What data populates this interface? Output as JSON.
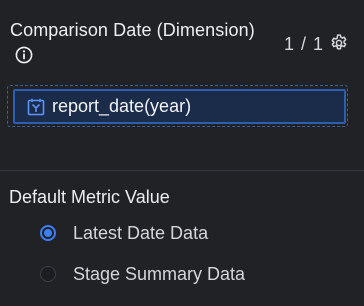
{
  "comparison_section": {
    "title": "Comparison Date (Dimension)",
    "info_icon": "info-circle-icon",
    "counter": "1 / 1",
    "settings_icon": "gear-icon",
    "field": {
      "icon": "date-field-icon",
      "label": "report_date(year)"
    }
  },
  "metric_section": {
    "title": "Default Metric Value",
    "options": [
      {
        "label": "Latest Date Data",
        "selected": true
      },
      {
        "label": "Stage Summary Data",
        "selected": false
      }
    ]
  },
  "colors": {
    "background": "#202226",
    "accent": "#3d7ff5",
    "chip_fill": "#1b2c4b"
  }
}
